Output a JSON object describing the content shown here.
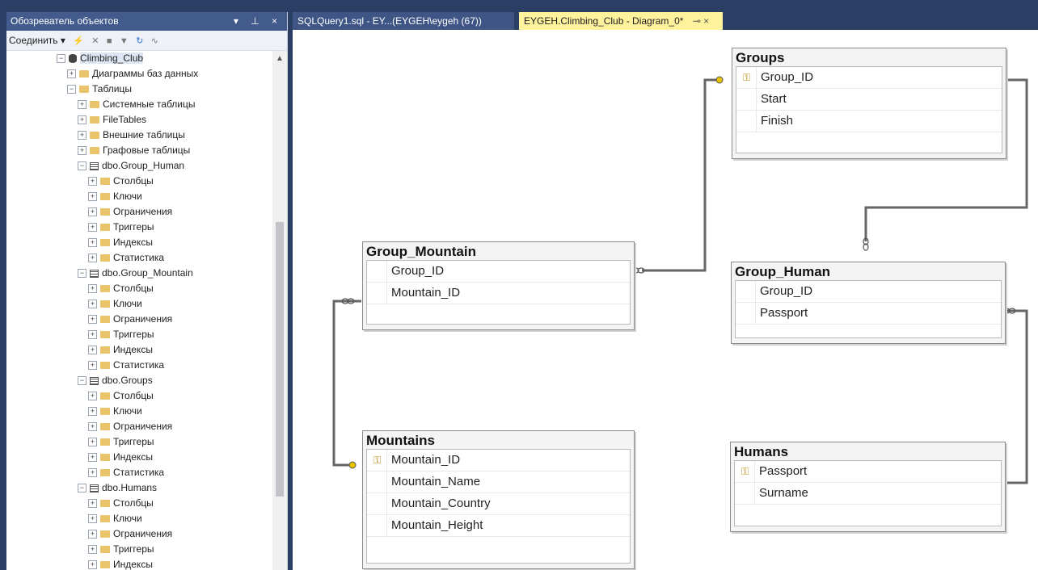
{
  "explorer": {
    "title": "Обозреватель объектов",
    "title_controls": "▾ ⊥ ×",
    "connect_label": "Соединить ▾",
    "tree": [
      {
        "label": "Climbing_Club",
        "level": 0,
        "icon": "database-icon",
        "exp": "minus"
      },
      {
        "label": "Диаграммы баз данных",
        "level": 1,
        "icon": "folder-icon",
        "exp": "plus"
      },
      {
        "label": "Таблицы",
        "level": 1,
        "icon": "folder-icon",
        "exp": "minus"
      },
      {
        "label": "Системные таблицы",
        "level": 2,
        "icon": "folder-icon",
        "exp": "plus"
      },
      {
        "label": "FileTables",
        "level": 2,
        "icon": "folder-icon",
        "exp": "plus"
      },
      {
        "label": "Внешние таблицы",
        "level": 2,
        "icon": "folder-icon",
        "exp": "plus"
      },
      {
        "label": "Графовые таблицы",
        "level": 2,
        "icon": "folder-icon",
        "exp": "plus"
      },
      {
        "label": "dbo.Group_Human",
        "level": 2,
        "icon": "table-icon",
        "exp": "minus"
      },
      {
        "label": "Столбцы",
        "level": 3,
        "icon": "folder-icon",
        "exp": "plus"
      },
      {
        "label": "Ключи",
        "level": 3,
        "icon": "folder-icon",
        "exp": "plus"
      },
      {
        "label": "Ограничения",
        "level": 3,
        "icon": "folder-icon",
        "exp": "plus"
      },
      {
        "label": "Триггеры",
        "level": 3,
        "icon": "folder-icon",
        "exp": "plus"
      },
      {
        "label": "Индексы",
        "level": 3,
        "icon": "folder-icon",
        "exp": "plus"
      },
      {
        "label": "Статистика",
        "level": 3,
        "icon": "folder-icon",
        "exp": "plus"
      },
      {
        "label": "dbo.Group_Mountain",
        "level": 2,
        "icon": "table-icon",
        "exp": "minus"
      },
      {
        "label": "Столбцы",
        "level": 3,
        "icon": "folder-icon",
        "exp": "plus"
      },
      {
        "label": "Ключи",
        "level": 3,
        "icon": "folder-icon",
        "exp": "plus"
      },
      {
        "label": "Ограничения",
        "level": 3,
        "icon": "folder-icon",
        "exp": "plus"
      },
      {
        "label": "Триггеры",
        "level": 3,
        "icon": "folder-icon",
        "exp": "plus"
      },
      {
        "label": "Индексы",
        "level": 3,
        "icon": "folder-icon",
        "exp": "plus"
      },
      {
        "label": "Статистика",
        "level": 3,
        "icon": "folder-icon",
        "exp": "plus"
      },
      {
        "label": "dbo.Groups",
        "level": 2,
        "icon": "table-icon",
        "exp": "minus"
      },
      {
        "label": "Столбцы",
        "level": 3,
        "icon": "folder-icon",
        "exp": "plus"
      },
      {
        "label": "Ключи",
        "level": 3,
        "icon": "folder-icon",
        "exp": "plus"
      },
      {
        "label": "Ограничения",
        "level": 3,
        "icon": "folder-icon",
        "exp": "plus"
      },
      {
        "label": "Триггеры",
        "level": 3,
        "icon": "folder-icon",
        "exp": "plus"
      },
      {
        "label": "Индексы",
        "level": 3,
        "icon": "folder-icon",
        "exp": "plus"
      },
      {
        "label": "Статистика",
        "level": 3,
        "icon": "folder-icon",
        "exp": "plus"
      },
      {
        "label": "dbo.Humans",
        "level": 2,
        "icon": "table-icon",
        "exp": "minus"
      },
      {
        "label": "Столбцы",
        "level": 3,
        "icon": "folder-icon",
        "exp": "plus"
      },
      {
        "label": "Ключи",
        "level": 3,
        "icon": "folder-icon",
        "exp": "plus"
      },
      {
        "label": "Ограничения",
        "level": 3,
        "icon": "folder-icon",
        "exp": "plus"
      },
      {
        "label": "Триггеры",
        "level": 3,
        "icon": "folder-icon",
        "exp": "plus"
      },
      {
        "label": "Индексы",
        "level": 3,
        "icon": "folder-icon",
        "exp": "plus"
      }
    ]
  },
  "tabs": {
    "query_tab": "SQLQuery1.sql - EY...(EYGEH\\eygeh (67))",
    "diagram_tab": "EYGEH.Climbing_Club - Diagram_0*",
    "diagram_tab_controls": "⊸ ×"
  },
  "diagram": {
    "tables": [
      {
        "name": "Groups",
        "columns": [
          {
            "name": "Group_ID",
            "pk": true
          },
          {
            "name": "Start",
            "pk": false
          },
          {
            "name": "Finish",
            "pk": false
          }
        ]
      },
      {
        "name": "Group_Mountain",
        "columns": [
          {
            "name": "Group_ID",
            "pk": false
          },
          {
            "name": "Mountain_ID",
            "pk": false
          }
        ]
      },
      {
        "name": "Group_Human",
        "columns": [
          {
            "name": "Group_ID",
            "pk": false
          },
          {
            "name": "Passport",
            "pk": false
          }
        ]
      },
      {
        "name": "Mountains",
        "columns": [
          {
            "name": "Mountain_ID",
            "pk": true
          },
          {
            "name": "Mountain_Name",
            "pk": false
          },
          {
            "name": "Mountain_Country",
            "pk": false
          },
          {
            "name": "Mountain_Height",
            "pk": false
          }
        ]
      },
      {
        "name": "Humans",
        "columns": [
          {
            "name": "Passport",
            "pk": true
          },
          {
            "name": "Surname",
            "pk": false
          }
        ]
      }
    ]
  },
  "colors": {
    "title_bar": "#425a8c",
    "frame": "#2b3e63",
    "active_tab": "#fff29d",
    "key": "#e6c200"
  }
}
